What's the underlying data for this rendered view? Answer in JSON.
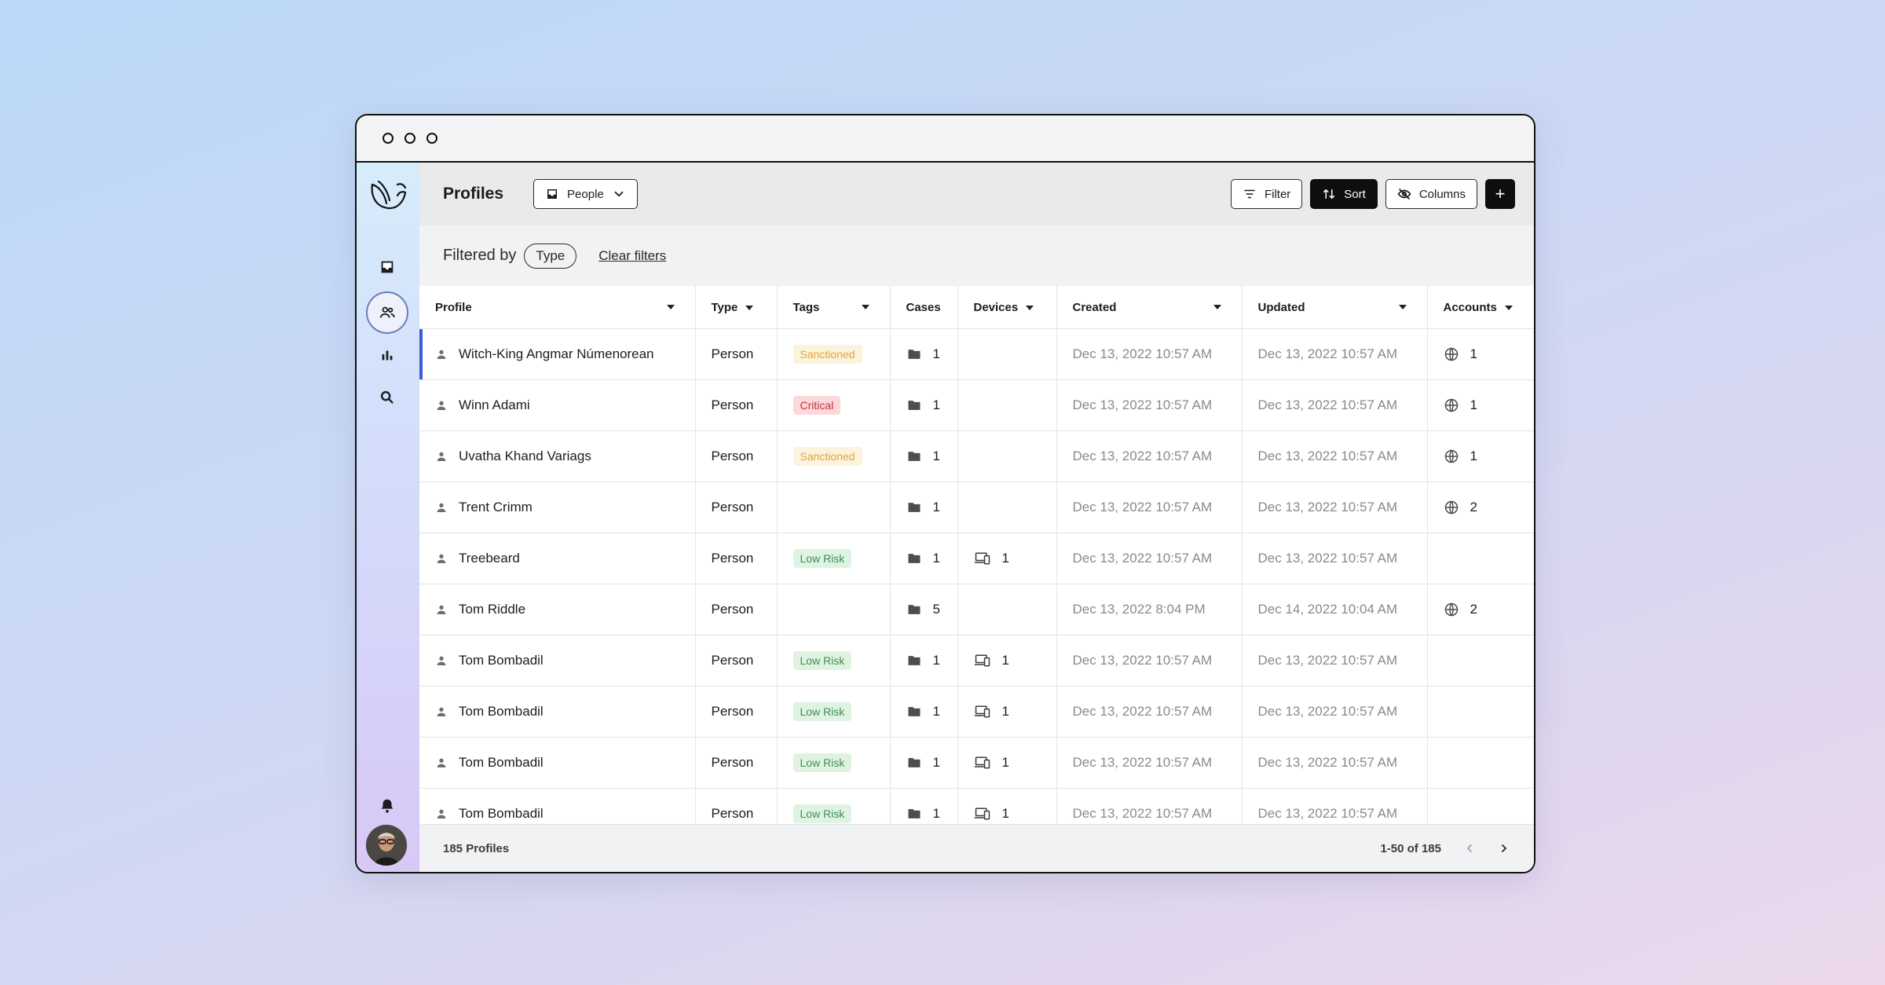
{
  "header": {
    "title": "Profiles",
    "view_label": "People"
  },
  "toolbar": {
    "filter_label": "Filter",
    "sort_label": "Sort",
    "columns_label": "Columns",
    "add_label": "+"
  },
  "filters": {
    "label": "Filtered by",
    "chip": "Type",
    "clear_label": "Clear filters"
  },
  "table": {
    "columns": [
      "Profile",
      "Type",
      "Tags",
      "Cases",
      "Devices",
      "Created",
      "Updated",
      "Accounts"
    ],
    "rows": [
      {
        "profile": "Witch-King Angmar Númenorean",
        "type": "Person",
        "tag": "Sanctioned",
        "tag_kind": "sanctioned",
        "cases": "1",
        "devices": "",
        "created": "Dec 13, 2022 10:57 AM",
        "updated": "Dec 13, 2022 10:57 AM",
        "accounts": "1"
      },
      {
        "profile": "Winn Adami",
        "type": "Person",
        "tag": "Critical",
        "tag_kind": "critical",
        "cases": "1",
        "devices": "",
        "created": "Dec 13, 2022 10:57 AM",
        "updated": "Dec 13, 2022 10:57 AM",
        "accounts": "1"
      },
      {
        "profile": "Uvatha Khand Variags",
        "type": "Person",
        "tag": "Sanctioned",
        "tag_kind": "sanctioned",
        "cases": "1",
        "devices": "",
        "created": "Dec 13, 2022 10:57 AM",
        "updated": "Dec 13, 2022 10:57 AM",
        "accounts": "1"
      },
      {
        "profile": "Trent Crimm",
        "type": "Person",
        "tag": "",
        "tag_kind": "",
        "cases": "1",
        "devices": "",
        "created": "Dec 13, 2022 10:57 AM",
        "updated": "Dec 13, 2022 10:57 AM",
        "accounts": "2"
      },
      {
        "profile": "Treebeard",
        "type": "Person",
        "tag": "Low Risk",
        "tag_kind": "lowrisk",
        "cases": "1",
        "devices": "1",
        "created": "Dec 13, 2022 10:57 AM",
        "updated": "Dec 13, 2022 10:57 AM",
        "accounts": ""
      },
      {
        "profile": "Tom Riddle",
        "type": "Person",
        "tag": "",
        "tag_kind": "",
        "cases": "5",
        "devices": "",
        "created": "Dec 13, 2022 8:04 PM",
        "updated": "Dec 14, 2022 10:04 AM",
        "accounts": "2"
      },
      {
        "profile": "Tom Bombadil",
        "type": "Person",
        "tag": "Low Risk",
        "tag_kind": "lowrisk",
        "cases": "1",
        "devices": "1",
        "created": "Dec 13, 2022 10:57 AM",
        "updated": "Dec 13, 2022 10:57 AM",
        "accounts": ""
      },
      {
        "profile": "Tom Bombadil",
        "type": "Person",
        "tag": "Low Risk",
        "tag_kind": "lowrisk",
        "cases": "1",
        "devices": "1",
        "created": "Dec 13, 2022 10:57 AM",
        "updated": "Dec 13, 2022 10:57 AM",
        "accounts": ""
      },
      {
        "profile": "Tom Bombadil",
        "type": "Person",
        "tag": "Low Risk",
        "tag_kind": "lowrisk",
        "cases": "1",
        "devices": "1",
        "created": "Dec 13, 2022 10:57 AM",
        "updated": "Dec 13, 2022 10:57 AM",
        "accounts": ""
      },
      {
        "profile": "Tom Bombadil",
        "type": "Person",
        "tag": "Low Risk",
        "tag_kind": "lowrisk",
        "cases": "1",
        "devices": "1",
        "created": "Dec 13, 2022 10:57 AM",
        "updated": "Dec 13, 2022 10:57 AM",
        "accounts": ""
      }
    ]
  },
  "footer": {
    "count_label": "185 Profiles",
    "range_label": "1-50 of 185"
  },
  "colors": {
    "accent": "#3b5bdb",
    "sanctioned": "#e0a640",
    "critical": "#c9313c",
    "low_risk": "#3f8f52"
  },
  "icons": [
    "bird-logo-icon",
    "inbox-icon",
    "people-icon",
    "bar-chart-icon",
    "search-icon",
    "bell-icon",
    "person-icon",
    "folder-icon",
    "devices-icon",
    "globe-icon",
    "filter-icon",
    "sort-icon",
    "eye-off-icon",
    "chevron-down-icon",
    "chevron-left-icon",
    "chevron-right-icon"
  ]
}
